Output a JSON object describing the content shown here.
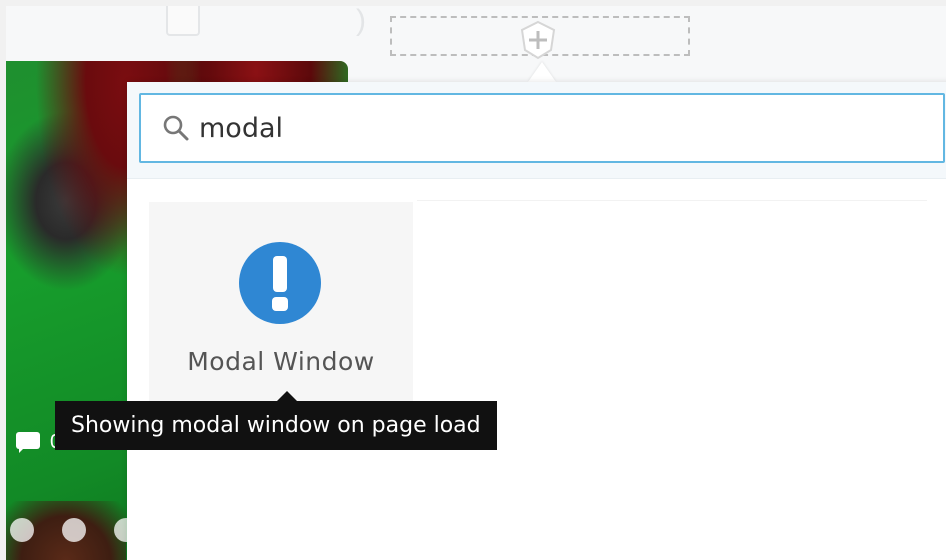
{
  "search": {
    "value": "modal",
    "icon": "search-icon"
  },
  "results": [
    {
      "label": "Modal Window",
      "icon": "exclamation-circle-icon",
      "icon_color": "#2f87d3"
    }
  ],
  "tooltip": {
    "text": "Showing modal window on page load"
  },
  "background": {
    "comment_count": "0",
    "comment_icon": "comment-icon"
  },
  "toolbar": {
    "add_icon": "plus-icon"
  },
  "colors": {
    "search_border": "#62b7e2",
    "tooltip_bg": "#111111",
    "drop_zone_border": "#bdbdbd"
  }
}
